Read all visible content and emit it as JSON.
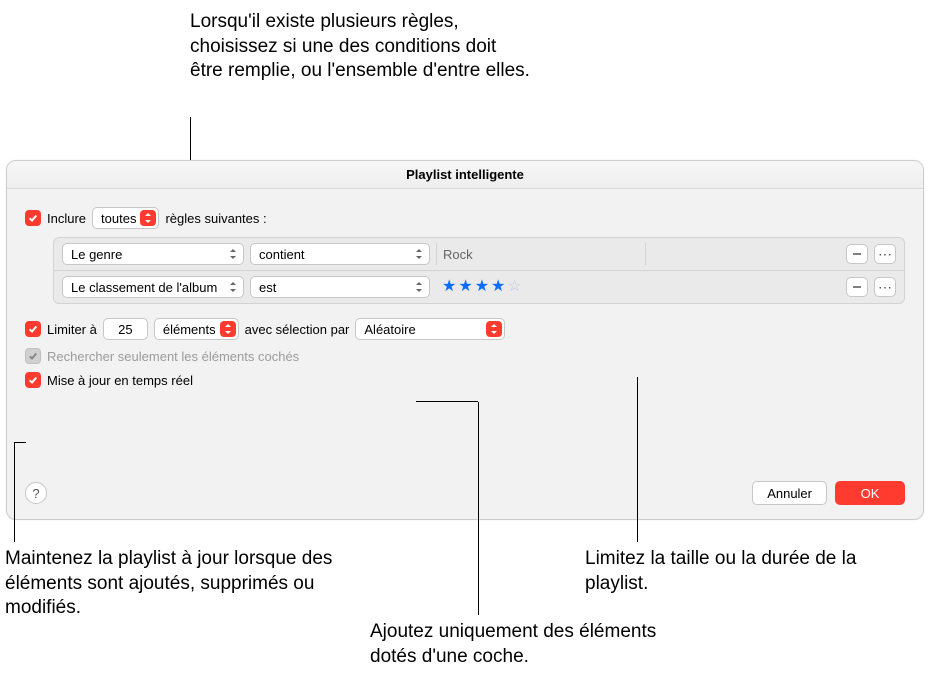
{
  "callouts": {
    "top": "Lorsqu'il existe plusieurs règles, choisissez si une des conditions doit être remplie, ou l'ensemble d'entre elles.",
    "bottom_left": "Maintenez la playlist à jour lorsque des éléments sont ajoutés, supprimés ou modifiés.",
    "bottom_mid": "Ajoutez uniquement des éléments dotés d'une coche.",
    "bottom_right": "Limitez la taille ou la durée de la playlist."
  },
  "dialog": {
    "title": "Playlist intelligente",
    "match": {
      "label_prefix": "Inclure",
      "mode": "toutes",
      "label_suffix": "règles suivantes :"
    },
    "rules": [
      {
        "field": "Le genre",
        "op": "contient",
        "value": "Rock"
      },
      {
        "field": "Le classement de l'album",
        "op": "est",
        "stars": 4
      }
    ],
    "limit": {
      "label": "Limiter à",
      "count": "25",
      "unit": "éléments",
      "sel_prefix": "avec sélection par",
      "method": "Aléatoire"
    },
    "only_checked": "Rechercher seulement les éléments cochés",
    "live_update": "Mise à jour en temps réel",
    "cancel": "Annuler",
    "ok": "OK",
    "help": "?"
  }
}
